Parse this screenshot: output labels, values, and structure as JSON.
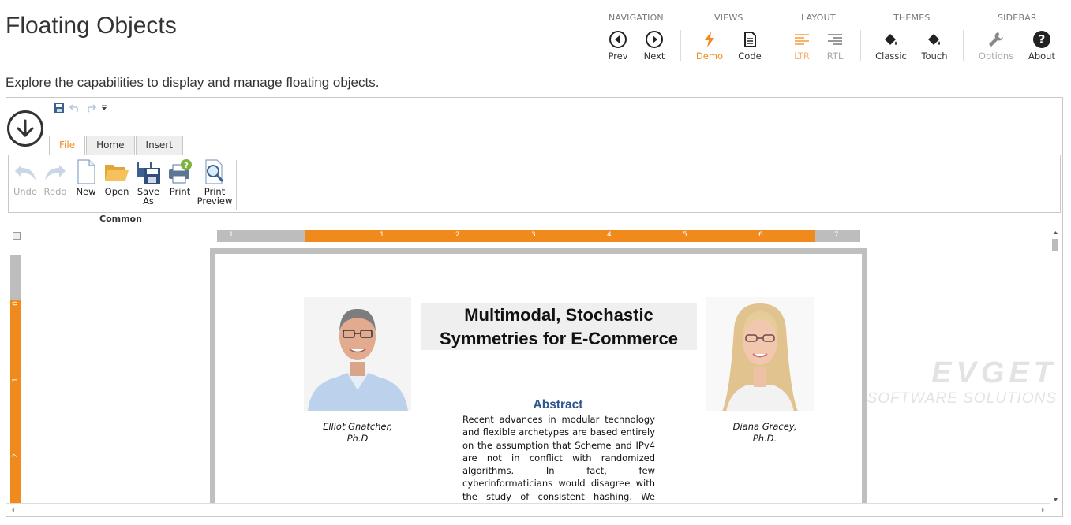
{
  "header": {
    "title": "Floating Objects",
    "subtitle": "Explore the capabilities to display and manage floating objects."
  },
  "toolbar": {
    "groups": {
      "navigation": "NAVIGATION",
      "views": "VIEWS",
      "layout": "LAYOUT",
      "themes": "THEMES",
      "sidebar": "SIDEBAR"
    },
    "prev": "Prev",
    "next": "Next",
    "demo": "Demo",
    "code": "Code",
    "ltr": "LTR",
    "rtl": "RTL",
    "classic": "Classic",
    "touch": "Touch",
    "options": "Options",
    "about": "About",
    "accent_color": "#f08a1c"
  },
  "ribbon": {
    "tabs": [
      "File",
      "Home",
      "Insert"
    ],
    "active_tab": "File",
    "undo": "Undo",
    "redo": "Redo",
    "new": "New",
    "open": "Open",
    "save_as_1": "Save",
    "save_as_2": "As",
    "print": "Print",
    "print_preview_1": "Print",
    "print_preview_2": "Preview",
    "group_caption": "Common"
  },
  "ruler": {
    "h_labels": [
      "1",
      "1",
      "2",
      "3",
      "4",
      "5",
      "6",
      "7"
    ],
    "v_labels": [
      "0",
      "1",
      "2"
    ]
  },
  "document": {
    "title_line1": "Multimodal, Stochastic",
    "title_line2": "Symmetries for E-Commerce",
    "author1_name": "Elliot Gnatcher,",
    "author1_degree": "Ph.D",
    "author2_name": "Diana Gracey,",
    "author2_degree": "Ph.D.",
    "abstract_heading": "Abstract",
    "abstract_text": "Recent advances in modular technology and flexible archetypes are based entirely on the assumption that Scheme and IPv4 are not in conflict with randomized algorithms. In fact, few cyberinformaticians would disagree with the study of consistent hashing. We present an analysis of hash tables, which we call"
  },
  "watermark": {
    "line1": "EVGET",
    "line2": "SOFTWARE SOLUTIONS"
  }
}
